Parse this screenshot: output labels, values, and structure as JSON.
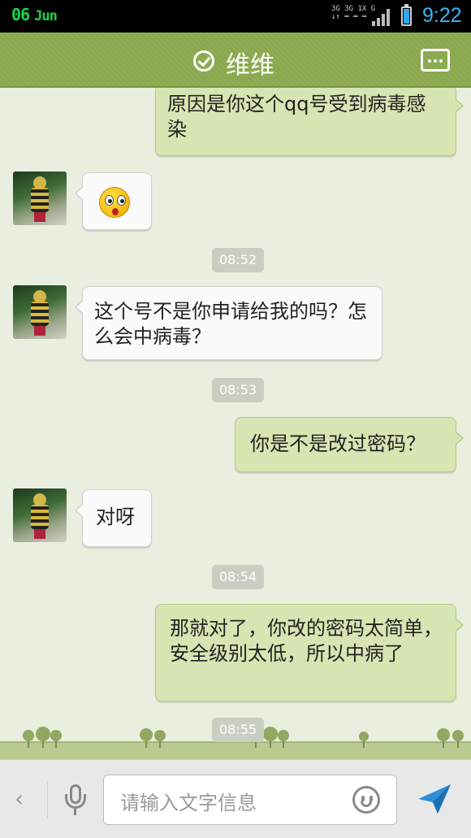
{
  "status_bar": {
    "date_day": "06",
    "date_month": "Jun",
    "network_line1": "3G 3G 1X  G",
    "network_line2": "↓↑ ═ ═   ═",
    "time": "9:22",
    "battery_level": 0.9,
    "colors": {
      "date": "#16d84a",
      "time": "#39b4f4"
    }
  },
  "title_bar": {
    "title": "维维",
    "check_icon": "check-circle-icon",
    "menu_icon": "more-icon",
    "color": "#8aa84e"
  },
  "messages": [
    {
      "side": "out",
      "text": "原因是你这个qq号受到病毒感染"
    },
    {
      "side": "in",
      "emoji": "surprised-emoji-icon"
    },
    {
      "timestamp": "08:52"
    },
    {
      "side": "in",
      "text": "这个号不是你申请给我的吗？怎么会中病毒？"
    },
    {
      "timestamp": "08:53"
    },
    {
      "side": "out",
      "text": "你是不是改过密码？"
    },
    {
      "side": "in",
      "text": "对呀"
    },
    {
      "timestamp": "08:54"
    },
    {
      "side": "out",
      "text": "那就对了，你改的密码太简单，安全级别太低，所以中病了"
    },
    {
      "timestamp": "08:55"
    }
  ],
  "input_bar": {
    "placeholder": "请输入文字信息",
    "icons": [
      "chevron-left-icon",
      "microphone-icon",
      "smiley-icon",
      "send-icon"
    ]
  }
}
